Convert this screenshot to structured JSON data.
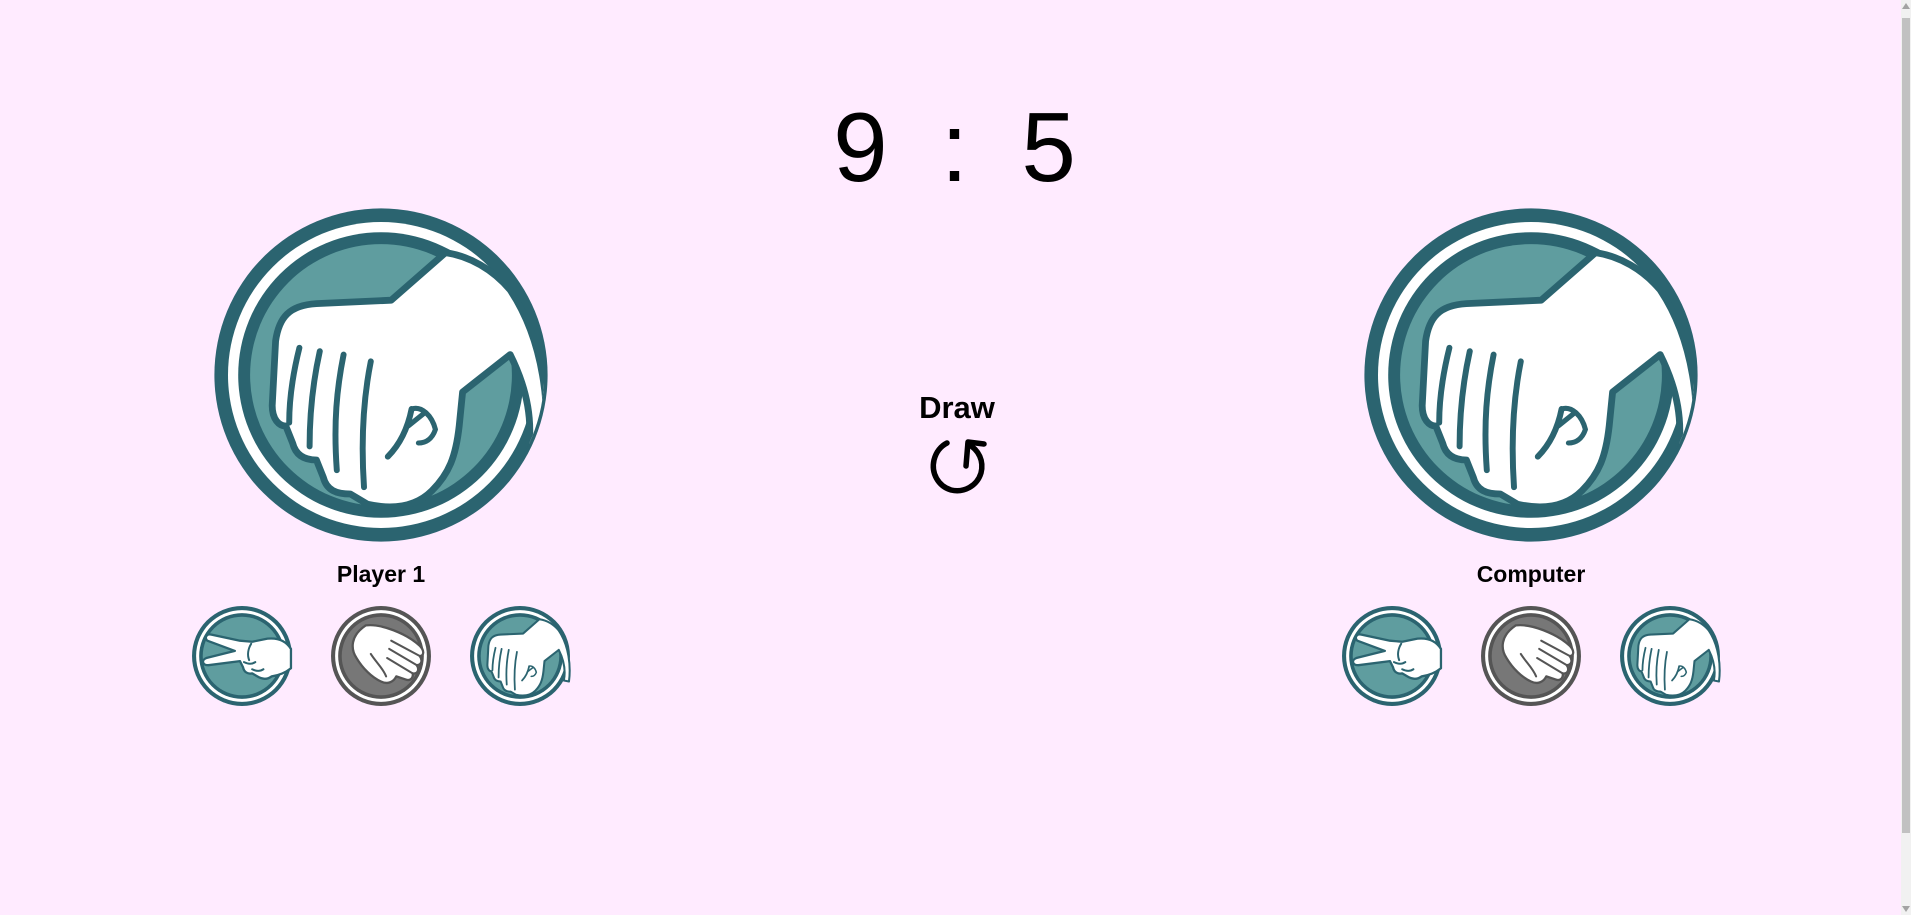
{
  "score": {
    "player": "9",
    "separator": ":",
    "computer": "5"
  },
  "result": {
    "text": "Draw",
    "reset_icon": "reset-icon"
  },
  "players": {
    "left": {
      "name": "Player 1",
      "current_choice": "rock",
      "choices": [
        {
          "name": "scissors",
          "icon": "scissors-icon",
          "state": "active"
        },
        {
          "name": "paper",
          "icon": "paper-icon",
          "state": "inactive"
        },
        {
          "name": "rock",
          "icon": "rock-icon",
          "state": "active"
        }
      ]
    },
    "right": {
      "name": "Computer",
      "current_choice": "rock",
      "choices": [
        {
          "name": "scissors",
          "icon": "scissors-icon",
          "state": "active"
        },
        {
          "name": "paper",
          "icon": "paper-icon",
          "state": "inactive"
        },
        {
          "name": "rock",
          "icon": "rock-icon",
          "state": "active"
        }
      ]
    }
  },
  "colors": {
    "background": "#ffebff",
    "ring_dark": "#2b6470",
    "fill_teal": "#5f9d9f",
    "ring_grey_dark": "#555555",
    "fill_grey": "#777777",
    "hand": "#ffffff"
  }
}
